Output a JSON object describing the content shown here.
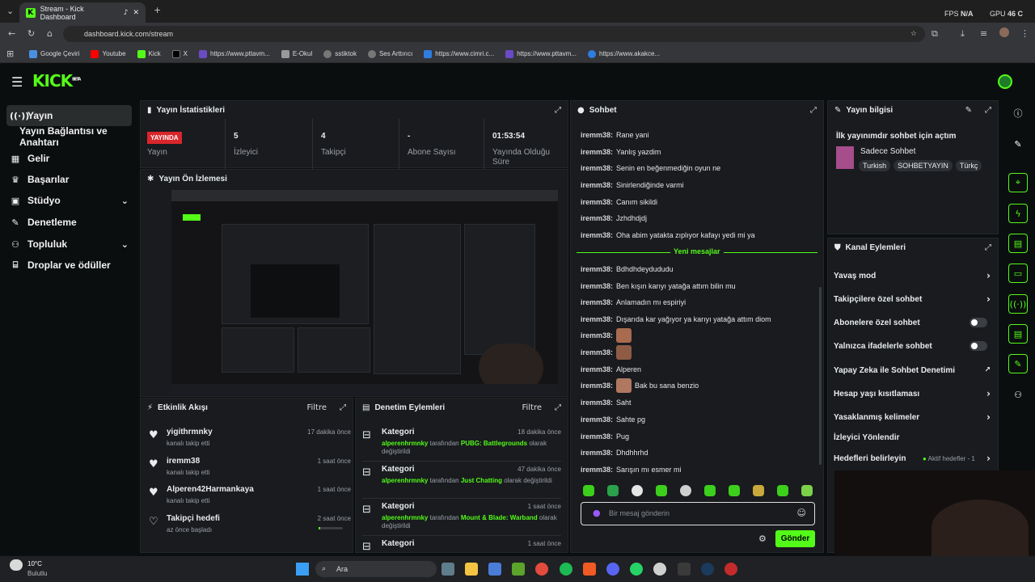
{
  "browser": {
    "tab_title": "Stream - Kick Dashboard",
    "url": "dashboard.kick.com/stream",
    "fps_label": "FPS",
    "fps_value": "N/A",
    "gpu_label": "GPU",
    "gpu_value": "46 C",
    "bookmarks": [
      "Google Çeviri",
      "Youtube",
      "Kick",
      "X",
      "https://www.pttavm...",
      "E-Okul",
      "sstiktok",
      "Ses Arttırıcı",
      "https://www.cimri.c...",
      "https://www.pttavm...",
      "https://www.akakce..."
    ]
  },
  "app": {
    "logo": "KICK",
    "logo_badge": "BETA"
  },
  "sidebar": {
    "items": [
      {
        "label": "Yayın",
        "icon": "broadcast-icon"
      },
      {
        "label": "Yayın Bağlantısı ve Anahtarı"
      },
      {
        "label": "Gelir",
        "icon": "revenue-icon"
      },
      {
        "label": "Başarılar",
        "icon": "trophy-icon"
      },
      {
        "label": "Stüdyo",
        "icon": "studio-icon"
      },
      {
        "label": "Denetleme",
        "icon": "wrench-icon"
      },
      {
        "label": "Topluluk",
        "icon": "community-icon"
      },
      {
        "label": "Droplar ve ödüller",
        "icon": "gift-icon"
      }
    ]
  },
  "stats": {
    "title": "Yayın İstatistikleri",
    "live": "YAYINDA",
    "live_label": "Yayın",
    "viewers": "5",
    "viewers_label": "İzleyici",
    "followers": "4",
    "followers_label": "Takipçi",
    "subs": "-",
    "subs_label": "Abone Sayısı",
    "uptime": "01:53:54",
    "uptime_label": "Yayında Olduğu Süre"
  },
  "preview": {
    "title": "Yayın Ön İzlemesi"
  },
  "activity": {
    "title": "Etkinlik Akışı",
    "filter": "Filtre",
    "items": [
      {
        "name": "yigithrmnky",
        "sub": "kanalı takip etti",
        "time": "17 dakika önce"
      },
      {
        "name": "iremm38",
        "sub": "kanalı takip etti",
        "time": "1 saat önce"
      },
      {
        "name": "Alperen42Harmankaya",
        "sub": "kanalı takip etti",
        "time": "1 saat önce"
      },
      {
        "name": "Takipçi hedefi",
        "sub": "az önce başladı",
        "time": "2 saat önce"
      }
    ]
  },
  "modlog": {
    "title": "Denetim Eylemleri",
    "filter": "Filtre",
    "items": [
      {
        "name": "Kategori",
        "time": "18 dakika önce",
        "user": "alperenhrmnky",
        "mid": "tarafından",
        "game": "PUBG: Battlegrounds",
        "end": "olarak değiştirildi"
      },
      {
        "name": "Kategori",
        "time": "47 dakika önce",
        "user": "alperenhrmnky",
        "mid": "tarafından",
        "game": "Just Chatting",
        "end": "olarak değiştirildi"
      },
      {
        "name": "Kategori",
        "time": "1 saat önce",
        "user": "alperenhrmnky",
        "mid": "tarafından",
        "game": "Mount & Blade: Warband",
        "end": "olarak değiştirildi"
      },
      {
        "name": "Kategori",
        "time": "1 saat önce"
      }
    ]
  },
  "chat": {
    "title": "Sohbet",
    "new_messages": "Yeni mesajlar",
    "messages": [
      {
        "user": "iremm38:",
        "text": "Rane yani"
      },
      {
        "user": "iremm38:",
        "text": "Yanlış yazdim"
      },
      {
        "user": "iremm38:",
        "text": "Senin en beğenmediğin oyun ne"
      },
      {
        "user": "iremm38:",
        "text": "Sinirlendiğinde varmi"
      },
      {
        "user": "iremm38:",
        "text": "Canım sikildi"
      },
      {
        "user": "iremm38:",
        "text": "Jzhdhdjdj"
      },
      {
        "user": "iremm38:",
        "text": "Oha abim yatakta zıplıyor kafayı yedi mi ya"
      },
      {
        "user": "iremm38:",
        "text": "Bdhdhdeydududu"
      },
      {
        "user": "iremm38:",
        "text": "Ben kışın karıyı yatağa attım bilin mu"
      },
      {
        "user": "iremm38:",
        "text": "Anlamadın mı espiriyi"
      },
      {
        "user": "iremm38:",
        "text": "Dışarıda kar yağıyor ya karıyı yatağa attım diom"
      },
      {
        "user": "iremm38:",
        "text": ""
      },
      {
        "user": "iremm38:",
        "text": ""
      },
      {
        "user": "iremm38:",
        "text": "Alperen"
      },
      {
        "user": "iremm38:",
        "text": "Bak bu sana benzio"
      },
      {
        "user": "iremm38:",
        "text": "Saht"
      },
      {
        "user": "iremm38:",
        "text": "Sahte pg"
      },
      {
        "user": "iremm38:",
        "text": "Pug"
      },
      {
        "user": "iremm38:",
        "text": "Dhdhhrhd"
      },
      {
        "user": "iremm38:",
        "text": "Sarışın mı esmer mi"
      }
    ],
    "placeholder": "Bir mesaj gönderin",
    "send": "Gönder"
  },
  "info": {
    "title": "Yayın bilgisi",
    "stream_title": "İlk yayınımdır sohbet için açtım",
    "category": "Sadece Sohbet",
    "tags": [
      "Turkish",
      "SOHBETYAYIN",
      "Türkç"
    ]
  },
  "channel_actions": {
    "title": "Kanal Eylemleri",
    "items": [
      {
        "label": "Yavaş mod",
        "kind": "arrow"
      },
      {
        "label": "Takipçilere özel sohbet",
        "kind": "arrow"
      },
      {
        "label": "Abonelere özel sohbet",
        "kind": "toggle"
      },
      {
        "label": "Yalnızca ifadelerle sohbet",
        "kind": "toggle"
      },
      {
        "label": "Yapay Zeka ile Sohbet Denetimi",
        "kind": "external"
      },
      {
        "label": "Hesap yaşı kısıtlaması",
        "kind": "arrow"
      },
      {
        "label": "Yasaklanmış kelimeler",
        "kind": "arrow"
      },
      {
        "label": "İzleyici Yönlendir",
        "kind": "none"
      },
      {
        "label": "Hedefleri belirleyin",
        "kind": "arrow"
      }
    ],
    "goals_status": "Aktif hedefler - 1"
  },
  "taskbar": {
    "temp": "10°C",
    "weather": "Bulutlu",
    "search": "Ara"
  }
}
